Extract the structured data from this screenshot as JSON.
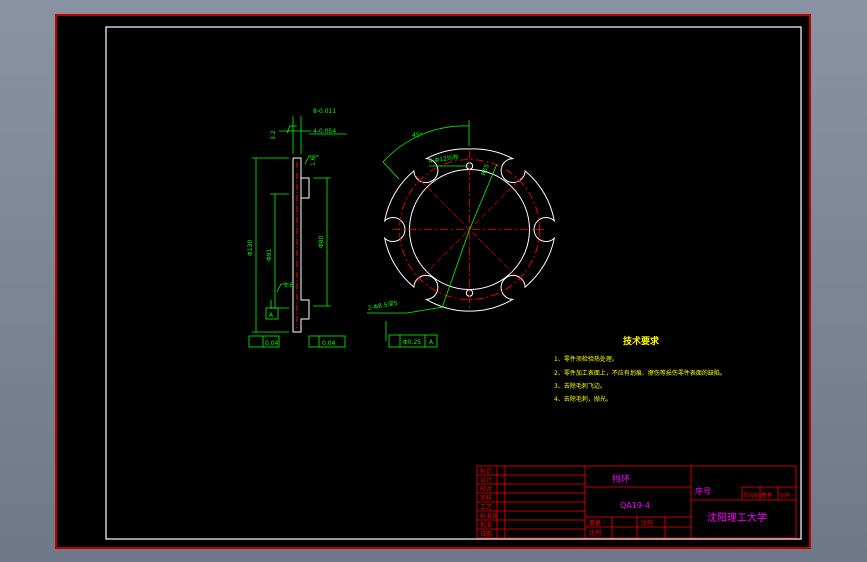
{
  "part": {
    "name": "挡环",
    "code": "QA19-4",
    "school": "沈阳理工大学",
    "seq_label": "序号"
  },
  "requirements": {
    "title": "技术要求",
    "items": [
      "1、零件须检验热处理。",
      "2、零件加工表面上，不应有划痕、擦伤等损伤零件表面的缺陷。",
      "3、去除毛刺飞边。",
      "4、去除毛刺，抛光。"
    ]
  },
  "dims": {
    "thk": "8-0.011",
    "chamfer_a": "4-0.054",
    "c1": "C0.5",
    "r1": "1.6",
    "ra": "3.2",
    "ra2": "1.6",
    "outer": "Φ130",
    "inner": "Φ91",
    "bore": "Φ80",
    "datum": "A",
    "tol_left": "0.04",
    "tol_right": "0.04",
    "angle": "45°",
    "slots": "4-Φ12均布",
    "radius": "R55",
    "holes": "2-Φ8.5深5",
    "pos_tol": "Φ0.25"
  },
  "title_block": {
    "rows": [
      "标记",
      "设计",
      "校对",
      "审核",
      "工艺",
      "标准化",
      "批准",
      "日期"
    ],
    "cols": [
      "阶段标记",
      "重量",
      "比例"
    ],
    "scale_label": "比例",
    "weight_label": "重量"
  },
  "colors": {
    "frame": "#ffffff",
    "dimension": "#00ff00",
    "centerline": "#ff0000",
    "text": "#ffff00",
    "title": "#ff00ff",
    "block": "#ff0000",
    "geometry": "#ffffff"
  }
}
